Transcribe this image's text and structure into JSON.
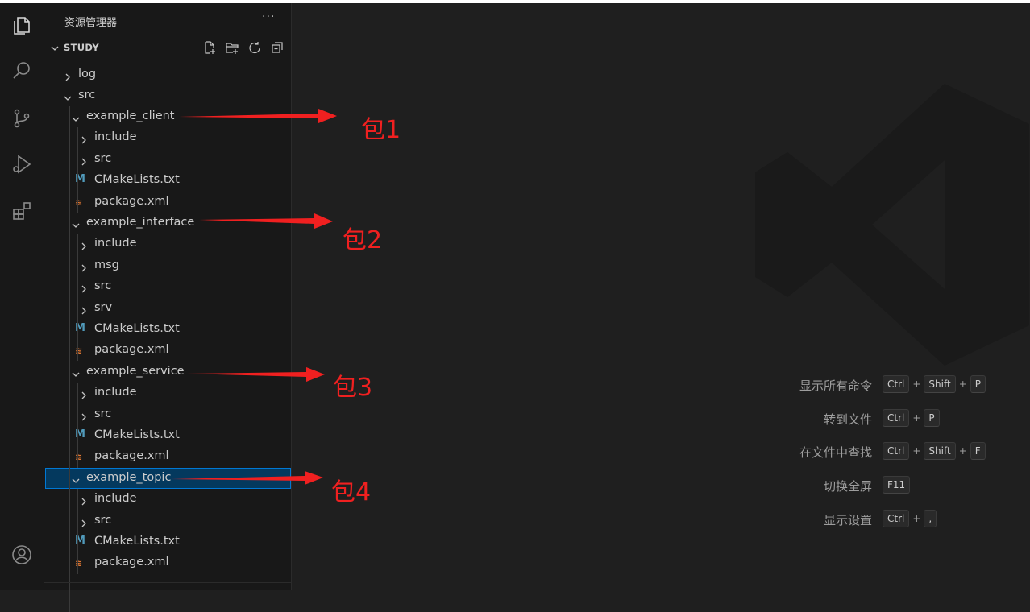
{
  "sidebar": {
    "title": "资源管理器",
    "more_label": "···",
    "section_title": "STUDY",
    "actions": [
      "new-file-icon",
      "new-folder-icon",
      "refresh-icon",
      "collapse-all-icon"
    ],
    "tree": [
      {
        "label": "log",
        "type": "folder",
        "expanded": false
      },
      {
        "label": "src",
        "type": "folder",
        "expanded": true
      },
      {
        "label": "example_client",
        "type": "folder",
        "expanded": true
      },
      {
        "label": "include",
        "type": "folder",
        "expanded": false
      },
      {
        "label": "src",
        "type": "folder",
        "expanded": false
      },
      {
        "label": "CMakeLists.txt",
        "type": "cmake"
      },
      {
        "label": "package.xml",
        "type": "xml"
      },
      {
        "label": "example_interface",
        "type": "folder",
        "expanded": true
      },
      {
        "label": "include",
        "type": "folder",
        "expanded": false
      },
      {
        "label": "msg",
        "type": "folder",
        "expanded": false
      },
      {
        "label": "src",
        "type": "folder",
        "expanded": false
      },
      {
        "label": "srv",
        "type": "folder",
        "expanded": false
      },
      {
        "label": "CMakeLists.txt",
        "type": "cmake"
      },
      {
        "label": "package.xml",
        "type": "xml"
      },
      {
        "label": "example_service",
        "type": "folder",
        "expanded": true
      },
      {
        "label": "include",
        "type": "folder",
        "expanded": false
      },
      {
        "label": "src",
        "type": "folder",
        "expanded": false
      },
      {
        "label": "CMakeLists.txt",
        "type": "cmake"
      },
      {
        "label": "package.xml",
        "type": "xml"
      },
      {
        "label": "example_topic",
        "type": "folder",
        "expanded": true,
        "selected": true
      },
      {
        "label": "include",
        "type": "folder",
        "expanded": false
      },
      {
        "label": "src",
        "type": "folder",
        "expanded": false
      },
      {
        "label": "CMakeLists.txt",
        "type": "cmake"
      },
      {
        "label": "package.xml",
        "type": "xml"
      }
    ],
    "file_icon_glyphs": {
      "cmake": "M",
      "xml": "≋"
    }
  },
  "activity_bar": [
    "explorer-icon",
    "search-icon",
    "source-control-icon",
    "run-debug-icon",
    "extensions-icon",
    "accounts-icon"
  ],
  "editor": {
    "shortcuts": [
      {
        "label": "显示所有命令",
        "keys": [
          "Ctrl",
          "Shift",
          "P"
        ]
      },
      {
        "label": "转到文件",
        "keys": [
          "Ctrl",
          "P"
        ]
      },
      {
        "label": "在文件中查找",
        "keys": [
          "Ctrl",
          "Shift",
          "F"
        ]
      },
      {
        "label": "切换全屏",
        "keys": [
          "F11"
        ]
      },
      {
        "label": "显示设置",
        "keys": [
          "Ctrl",
          ","
        ]
      }
    ],
    "key_separator": "+"
  },
  "annotations": [
    {
      "text": "包1"
    },
    {
      "text": "包2"
    },
    {
      "text": "包3"
    },
    {
      "text": "包4"
    }
  ],
  "colors": {
    "background": "#1f1f1f",
    "sidebar": "#181818",
    "selection": "#04395e",
    "selection_border": "#0078d4",
    "annotation_red": "#f02020",
    "cmake_icon": "#519aba",
    "xml_icon": "#e37933"
  }
}
